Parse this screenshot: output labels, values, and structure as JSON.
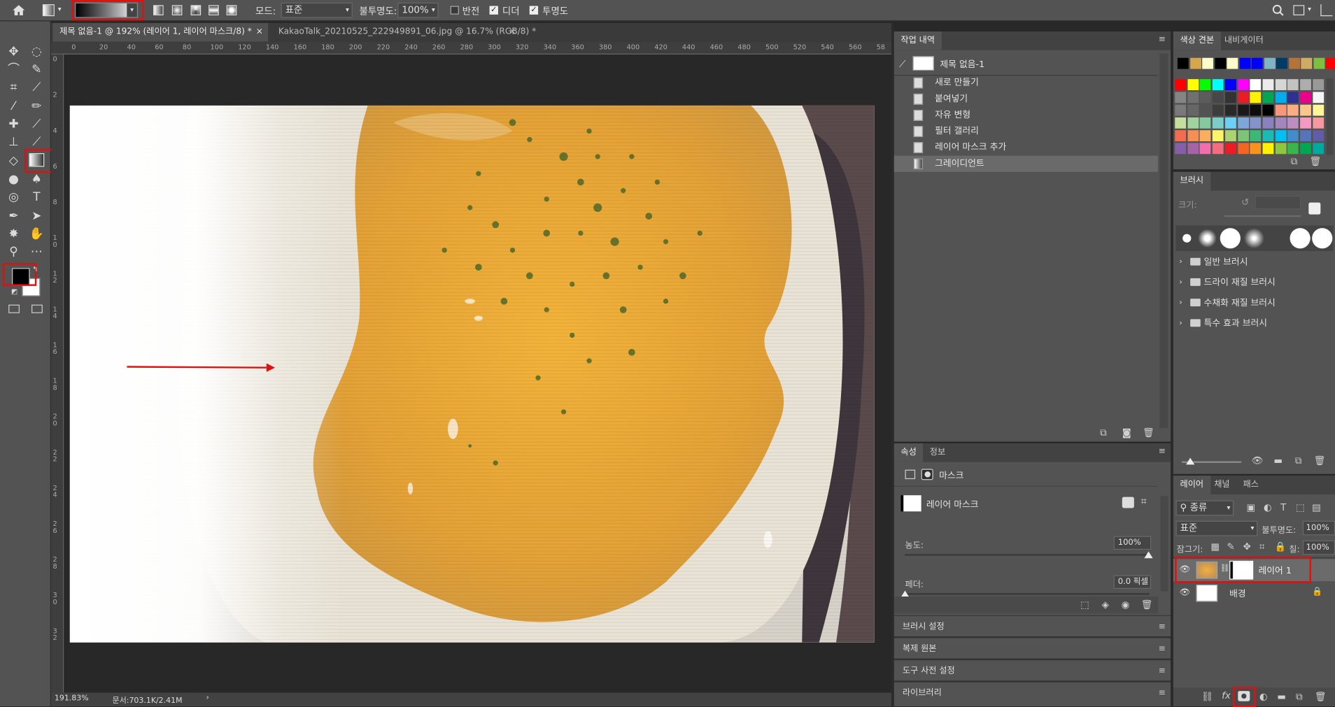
{
  "options_bar": {
    "mode_label": "모드:",
    "mode_value": "표준",
    "opacity_label": "불투명도:",
    "opacity_value": "100%",
    "reverse_label": "반전",
    "dither_label": "디더",
    "transparency_label": "투명도"
  },
  "tabs": [
    {
      "label": "제목 없음-1 @ 192% (레이어 1, 레이어 마스크/8) *",
      "close": "×"
    },
    {
      "label": "KakaoTalk_20210525_222949891_06.jpg @ 16.7% (RGB/8) *",
      "close": "×"
    }
  ],
  "ruler": {
    "h_ticks": [
      "0",
      "20",
      "40",
      "60",
      "80",
      "100",
      "120",
      "140",
      "160",
      "180",
      "200",
      "220",
      "240",
      "260",
      "280",
      "300",
      "320",
      "340",
      "360",
      "380",
      "400",
      "420",
      "440",
      "460",
      "480",
      "500",
      "520",
      "540",
      "560",
      "58"
    ],
    "v_ticks": [
      "0",
      "2",
      "4",
      "6",
      "8",
      "1 0",
      "1 2",
      "1 4",
      "1 6",
      "1 8",
      "2 0",
      "2 2",
      "2 4",
      "2 6",
      "2 8",
      "3 0",
      "3 2"
    ]
  },
  "status": {
    "zoom": "191.83%",
    "doc": "문서:703.1K/2.41M",
    "arrow": "›"
  },
  "history": {
    "title": "작업 내역",
    "snapshot": "제목 없음-1",
    "items": [
      "새로 만들기",
      "붙여넣기",
      "자유 변형",
      "필터 갤러리",
      "레이어 마스크 추가",
      "그레이디언트"
    ]
  },
  "properties": {
    "tab1": "속성",
    "tab2": "정보",
    "mask_label": "마스크",
    "layer_mask_label": "레이어 마스크",
    "density_label": "농도:",
    "density_value": "100%",
    "feather_label": "페더:",
    "feather_value": "0.0 픽셀"
  },
  "collapsed_panels": [
    "브러시 설정",
    "복제 원본",
    "도구 사전 설정",
    "라이브러리"
  ],
  "swatches": {
    "tab1": "색상 견본",
    "tab2": "내비게이터",
    "recent": [
      "#000000",
      "#d6a64a",
      "#ffffcc",
      "#000000",
      "#fffccc",
      "#0000ff",
      "#0000ff",
      "#7fb4c8",
      "#003b66",
      "#b5733a",
      "#ceac63",
      "#7fbf3f",
      "#ff0000"
    ],
    "rows": [
      [
        "#ff0000",
        "#ffff00",
        "#00ff00",
        "#00ffff",
        "#0000ff",
        "#ff00ff",
        "#ffffff",
        "#ebebeb",
        "#d6d6d6",
        "#c2c2c2",
        "#adadad",
        "#999999"
      ],
      [
        "#858585",
        "#707070",
        "#5c5c5c",
        "#474747",
        "#333333",
        "#ed1c24",
        "#fff200",
        "#00a651",
        "#00aeef",
        "#2e3192",
        "#ec008c",
        "#f5f5f5"
      ],
      [
        "#7a7a7a",
        "#666666",
        "#525252",
        "#3d3d3d",
        "#292929",
        "#1a1a1a",
        "#0d0d0d",
        "#000000",
        "#f7977a",
        "#f9ad81",
        "#fdc68a",
        "#fff79a"
      ],
      [
        "#c4df9b",
        "#a3d39c",
        "#82ca9d",
        "#7bcdc8",
        "#6ecff6",
        "#7ea7d8",
        "#8493ca",
        "#8882be",
        "#a187be",
        "#bc8dbf",
        "#f49ac2",
        "#f6989d"
      ],
      [
        "#f26c4f",
        "#f68e55",
        "#fbaf5c",
        "#fff467",
        "#acd372",
        "#7cc576",
        "#3bb878",
        "#1abbb4",
        "#00bff3",
        "#438ccb",
        "#5574b9",
        "#605ca8"
      ],
      [
        "#855fa8",
        "#a763a8",
        "#f06eaa",
        "#f26d7d",
        "#ed1c24",
        "#f26522",
        "#f7941d",
        "#fff200",
        "#8dc63f",
        "#39b54a",
        "#00a651",
        "#00a99d"
      ]
    ]
  },
  "brushes": {
    "title": "브러시",
    "size_label": "크기:",
    "folders": [
      "일반 브러시",
      "드라이 재질 브러시",
      "수채화 재질 브러시",
      "특수 효과 브러시"
    ]
  },
  "layers": {
    "tab1": "레이어",
    "tab2": "채널",
    "tab3": "패스",
    "filter_label": "종류",
    "blend_value": "표준",
    "opacity_label": "불투명도:",
    "opacity_value": "100%",
    "lock_label": "잠그기:",
    "fill_label": "칠:",
    "fill_value": "100%",
    "items": [
      {
        "name": "레이어 1"
      },
      {
        "name": "배경"
      }
    ]
  },
  "colors": {
    "highlight": "#e01010",
    "arrow": "#e01010"
  }
}
